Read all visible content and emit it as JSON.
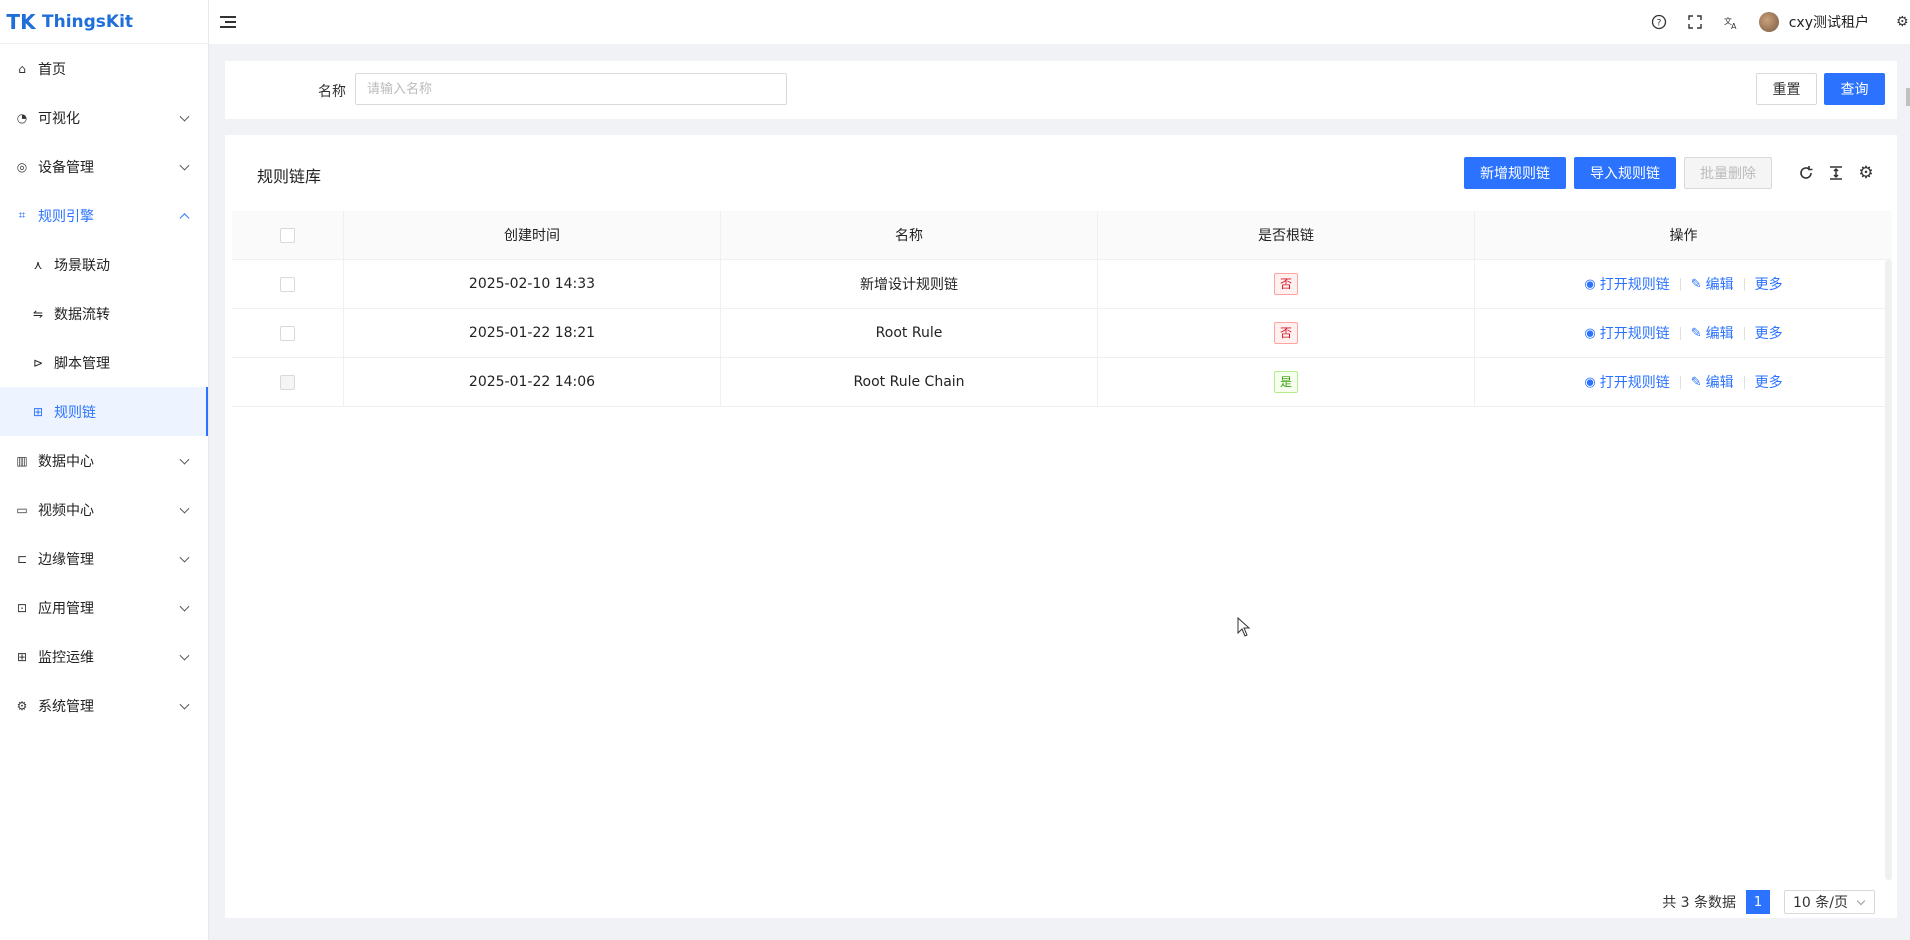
{
  "app": {
    "logo_mark": "TK",
    "logo_text": "ThingsKit"
  },
  "sidebar": {
    "items": [
      {
        "label": "首页",
        "icon": "home-icon",
        "glyph": "⌂"
      },
      {
        "label": "可视化",
        "icon": "dashboard-icon",
        "glyph": "◔"
      },
      {
        "label": "设备管理",
        "icon": "device-icon",
        "glyph": "◎"
      },
      {
        "label": "规则引擎",
        "icon": "rule-engine-icon",
        "glyph": "⌗"
      },
      {
        "label": "数据中心",
        "icon": "chart-icon",
        "glyph": "▥"
      },
      {
        "label": "视频中心",
        "icon": "video-icon",
        "glyph": "▭"
      },
      {
        "label": "边缘管理",
        "icon": "edge-icon",
        "glyph": "⊏"
      },
      {
        "label": "应用管理",
        "icon": "app-icon",
        "glyph": "⊡"
      },
      {
        "label": "监控运维",
        "icon": "monitor-icon",
        "glyph": "⊞"
      },
      {
        "label": "系统管理",
        "icon": "settings-icon",
        "glyph": "⚙"
      }
    ],
    "sub_items": [
      {
        "label": "场景联动",
        "icon": "scene-icon",
        "glyph": "⋏"
      },
      {
        "label": "数据流转",
        "icon": "flow-icon",
        "glyph": "⇋"
      },
      {
        "label": "脚本管理",
        "icon": "script-icon",
        "glyph": "⊳"
      },
      {
        "label": "规则链",
        "icon": "rule-chain-icon",
        "glyph": "⊞"
      }
    ]
  },
  "header": {
    "username": "cxy测试租户"
  },
  "search": {
    "label": "名称",
    "placeholder": "请输入名称",
    "reset": "重置",
    "query": "查询"
  },
  "table": {
    "title": "规则链库",
    "add_button": "新增规则链",
    "import_button": "导入规则链",
    "batch_delete_button": "批量删除",
    "columns": [
      "创建时间",
      "名称",
      "是否根链",
      "操作"
    ],
    "rows": [
      {
        "created": "2025-02-10 14:33",
        "name": "新增设计规则链",
        "root": "否",
        "is_root": false
      },
      {
        "created": "2025-01-22 18:21",
        "name": "Root Rule",
        "root": "否",
        "is_root": false
      },
      {
        "created": "2025-01-22 14:06",
        "name": "Root Rule Chain",
        "root": "是",
        "is_root": true
      }
    ],
    "actions": {
      "open": "打开规则链",
      "edit": "编辑",
      "more": "更多"
    }
  },
  "pagination": {
    "total_text": "共 3 条数据",
    "current_page": "1",
    "page_size": "10 条/页"
  },
  "colors": {
    "primary": "#2b73ff",
    "danger": "#cf1322",
    "success": "#389e0d"
  }
}
